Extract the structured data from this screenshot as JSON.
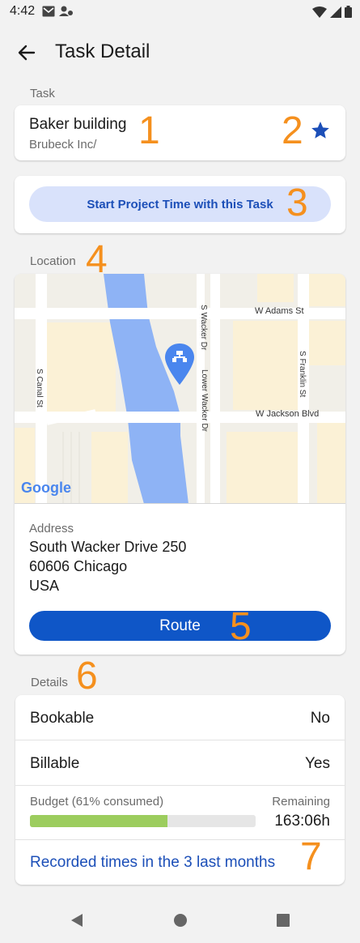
{
  "status_bar": {
    "time": "4:42"
  },
  "app_bar": {
    "title": "Task Detail"
  },
  "task_section": {
    "label": "Task",
    "title": "Baker building",
    "subtitle": "Brubeck Inc/",
    "marker_1": "1",
    "marker_2": "2"
  },
  "project_time": {
    "button_label": "Start Project Time with this Task",
    "marker": "3"
  },
  "location_section": {
    "label": "Location",
    "marker": "4",
    "map": {
      "streets": [
        "W Adams St",
        "S Wacker Dr",
        "Lower Wacker Dr",
        "S Franklin St",
        "S Canal St",
        "W Jackson Blvd"
      ],
      "attribution": "Google"
    },
    "address_label": "Address",
    "address_lines": [
      "South Wacker Drive 250",
      "60606 Chicago",
      "USA"
    ],
    "route_label": "Route",
    "route_marker": "5"
  },
  "details_section": {
    "label": "Details",
    "marker": "6",
    "rows": [
      {
        "label": "Bookable",
        "value": "No"
      },
      {
        "label": "Billable",
        "value": "Yes"
      }
    ],
    "budget": {
      "label": "Budget (61% consumed)",
      "consumed_fraction": 0.61,
      "remaining_label": "Remaining",
      "remaining_value": "163:06h"
    },
    "recorded_link": "Recorded times in the 3 last months",
    "link_marker": "7"
  },
  "colors": {
    "accent": "#0f56c7",
    "marker": "#f5901e",
    "progress": "#9ccd5e",
    "pill_bg": "#d9e2fb"
  },
  "icons": [
    "mail-icon",
    "account-icon",
    "wifi-icon",
    "signal-icon",
    "battery-icon",
    "back-arrow-icon",
    "star-icon",
    "map-pin-icon",
    "nav-back-icon",
    "nav-home-icon",
    "nav-recents-icon"
  ]
}
